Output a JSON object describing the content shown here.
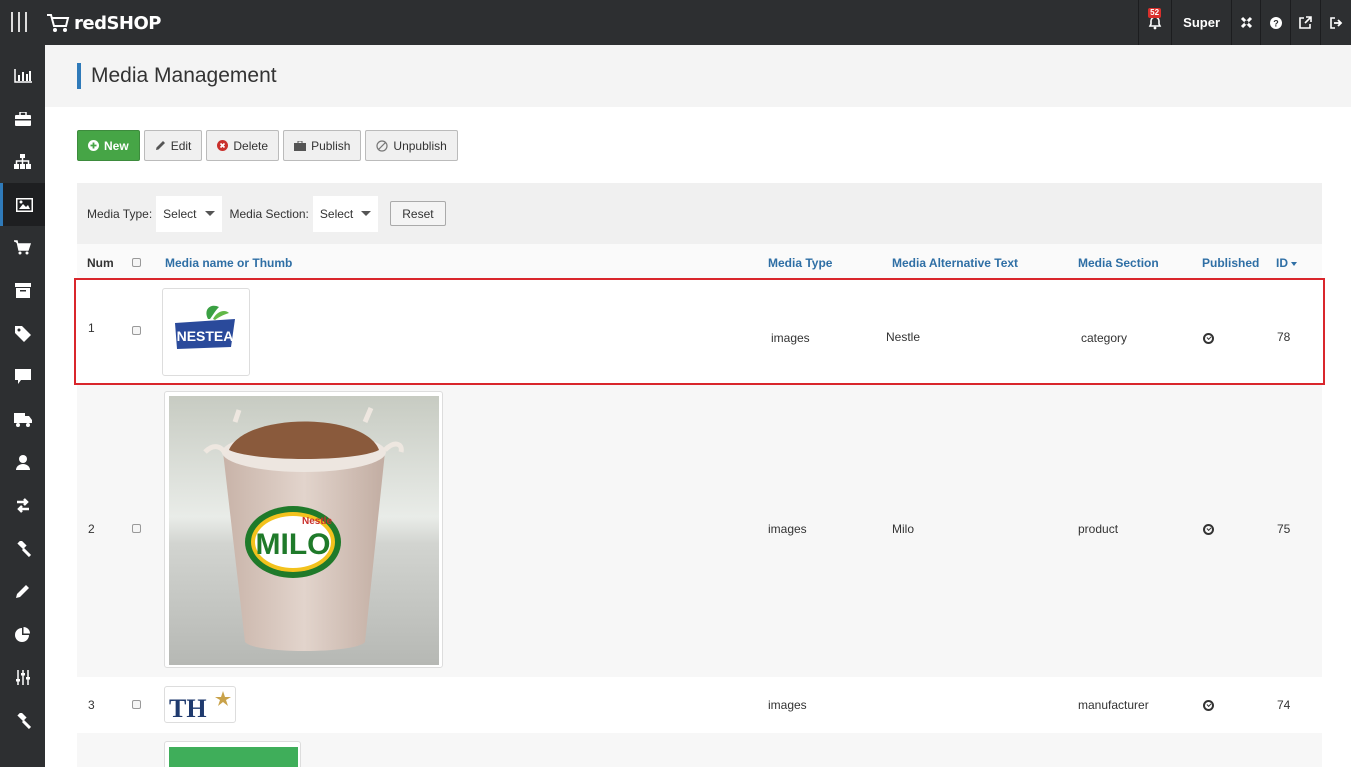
{
  "brand": {
    "name": "redSHOP"
  },
  "topbar": {
    "notifications_count": "52",
    "user": "Super"
  },
  "page": {
    "title": "Media Management"
  },
  "toolbar": {
    "new": "New",
    "edit": "Edit",
    "delete": "Delete",
    "publish": "Publish",
    "unpublish": "Unpublish"
  },
  "filters": {
    "media_type_label": "Media Type:",
    "media_type_value": "Select",
    "media_section_label": "Media Section:",
    "media_section_value": "Select",
    "reset": "Reset"
  },
  "table": {
    "headers": {
      "num": "Num",
      "name": "Media name or Thumb",
      "type": "Media Type",
      "alt": "Media Alternative Text",
      "section": "Media Section",
      "published": "Published",
      "id": "ID"
    },
    "rows": [
      {
        "num": "1",
        "thumb": "NESTEA",
        "type": "images",
        "alt": "Nestle",
        "section": "category",
        "id": "78"
      },
      {
        "num": "2",
        "thumb": "MILO",
        "type": "images",
        "alt": "Milo",
        "section": "product",
        "id": "75"
      },
      {
        "num": "3",
        "thumb": "TH",
        "type": "images",
        "alt": "",
        "section": "manufacturer",
        "id": "74"
      }
    ]
  },
  "colors": {
    "accent": "#2f7ab9",
    "sidebar": "#2d2f31",
    "new_button": "#46a546",
    "highlight": "#d9262c"
  }
}
